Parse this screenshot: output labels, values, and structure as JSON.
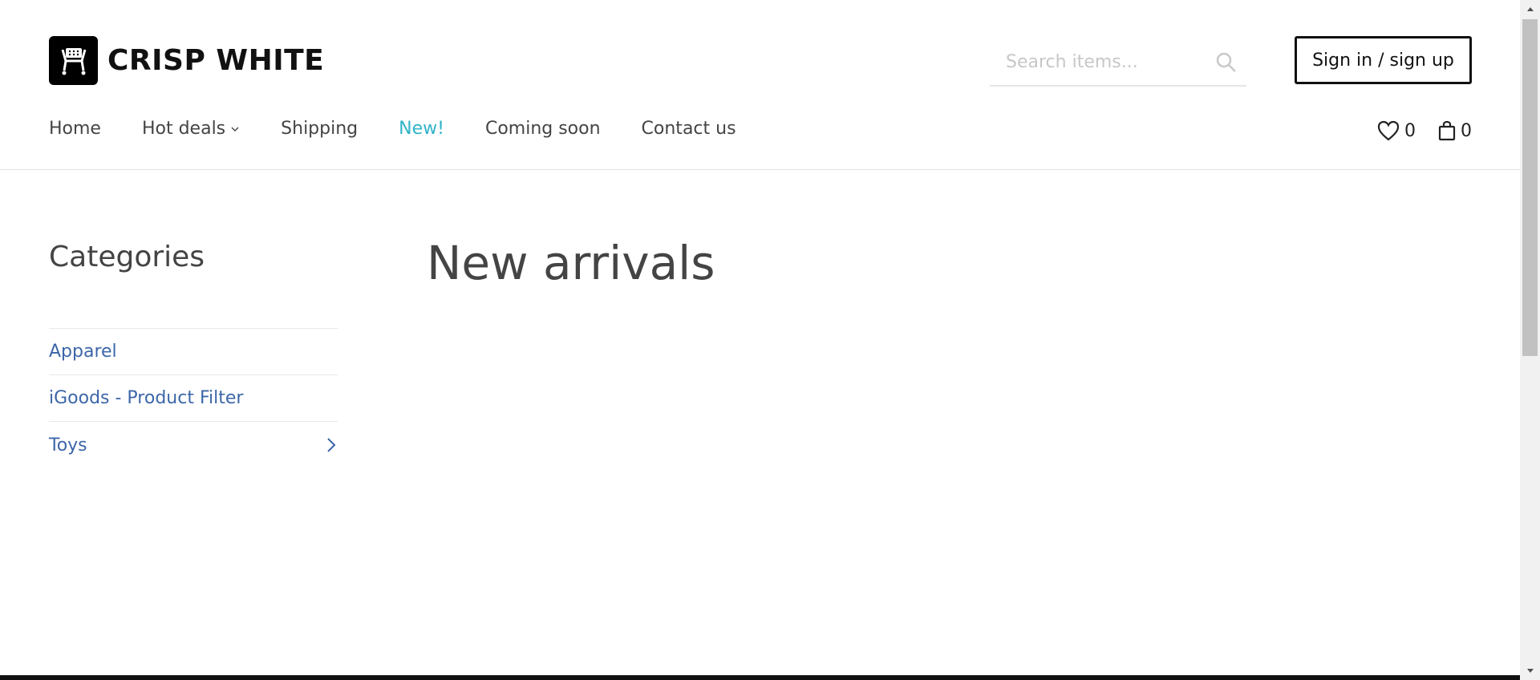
{
  "brand": {
    "name": "CRISP WHITE",
    "logo_icon": "store-logo-icon"
  },
  "search": {
    "placeholder": "Search items..."
  },
  "auth": {
    "signin_label": "Sign in / sign up"
  },
  "nav": {
    "home": "Home",
    "hot_deals": "Hot deals",
    "shipping": "Shipping",
    "new": "New!",
    "coming_soon": "Coming soon",
    "contact_us": "Contact us"
  },
  "counters": {
    "wishlist": "0",
    "cart": "0"
  },
  "sidebar": {
    "title": "Categories",
    "items": [
      {
        "label": "Apparel"
      },
      {
        "label": "iGoods - Product Filter"
      },
      {
        "label": "Toys"
      }
    ]
  },
  "main": {
    "title": "New arrivals"
  },
  "colors": {
    "accent": "#2fb3c8",
    "link": "#3c66a8",
    "text": "#444444"
  }
}
